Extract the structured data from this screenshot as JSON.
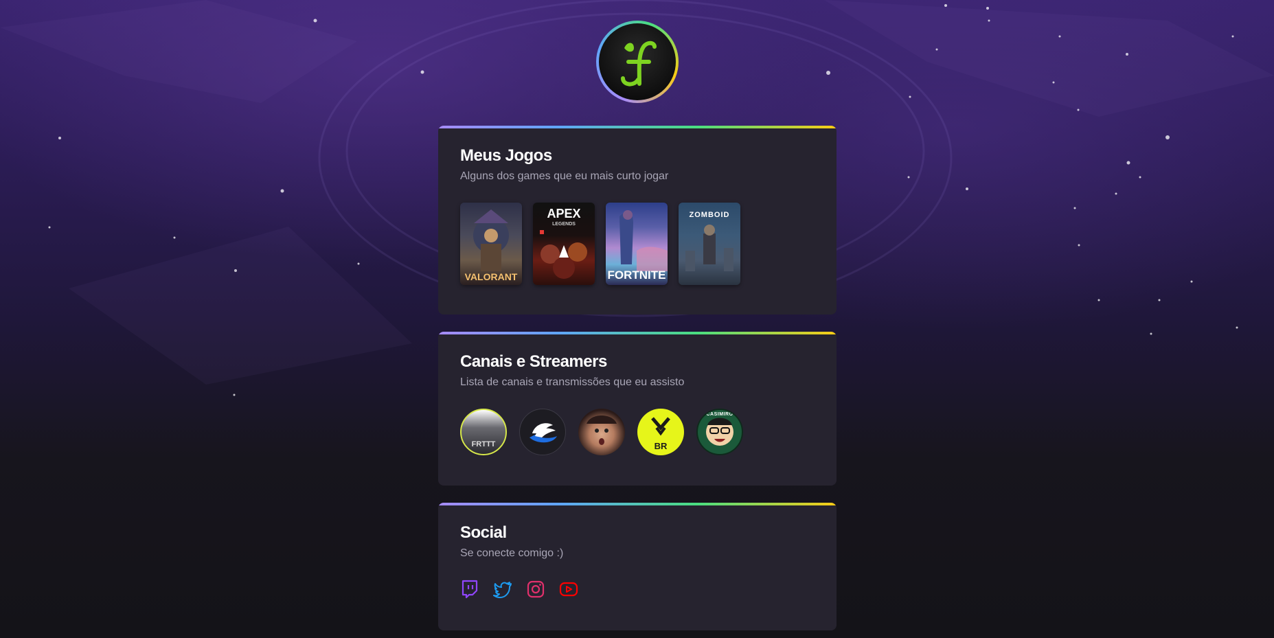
{
  "profile": {
    "logo_letter": "f",
    "logo_color": "#7ed321"
  },
  "games_section": {
    "title": "Meus Jogos",
    "subtitle": "Alguns dos games que eu mais curto jogar",
    "games": [
      {
        "name": "VALORANT"
      },
      {
        "name": "APEX",
        "sub": "LEGENDS"
      },
      {
        "name": "FORTNITE"
      },
      {
        "name": "ZOMBOID"
      }
    ]
  },
  "streamers_section": {
    "title": "Canais e Streamers",
    "subtitle": "Lista de canais e transmissões que eu assisto",
    "streamers": [
      {
        "icon": "frttt-avatar",
        "text": "FRTTT"
      },
      {
        "icon": "wing-avatar"
      },
      {
        "icon": "face-avatar"
      },
      {
        "icon": "vct-br-avatar",
        "text": "BR"
      },
      {
        "icon": "casimiro-avatar",
        "text": "CASIMIRO"
      }
    ]
  },
  "social_section": {
    "title": "Social",
    "subtitle": "Se conecte comigo :)",
    "links": [
      {
        "icon": "twitch-icon",
        "color": "#9146ff"
      },
      {
        "icon": "twitter-icon",
        "color": "#1d9bf0"
      },
      {
        "icon": "instagram-icon",
        "color": "#e1306c"
      },
      {
        "icon": "youtube-icon",
        "color": "#ff0000"
      }
    ]
  }
}
